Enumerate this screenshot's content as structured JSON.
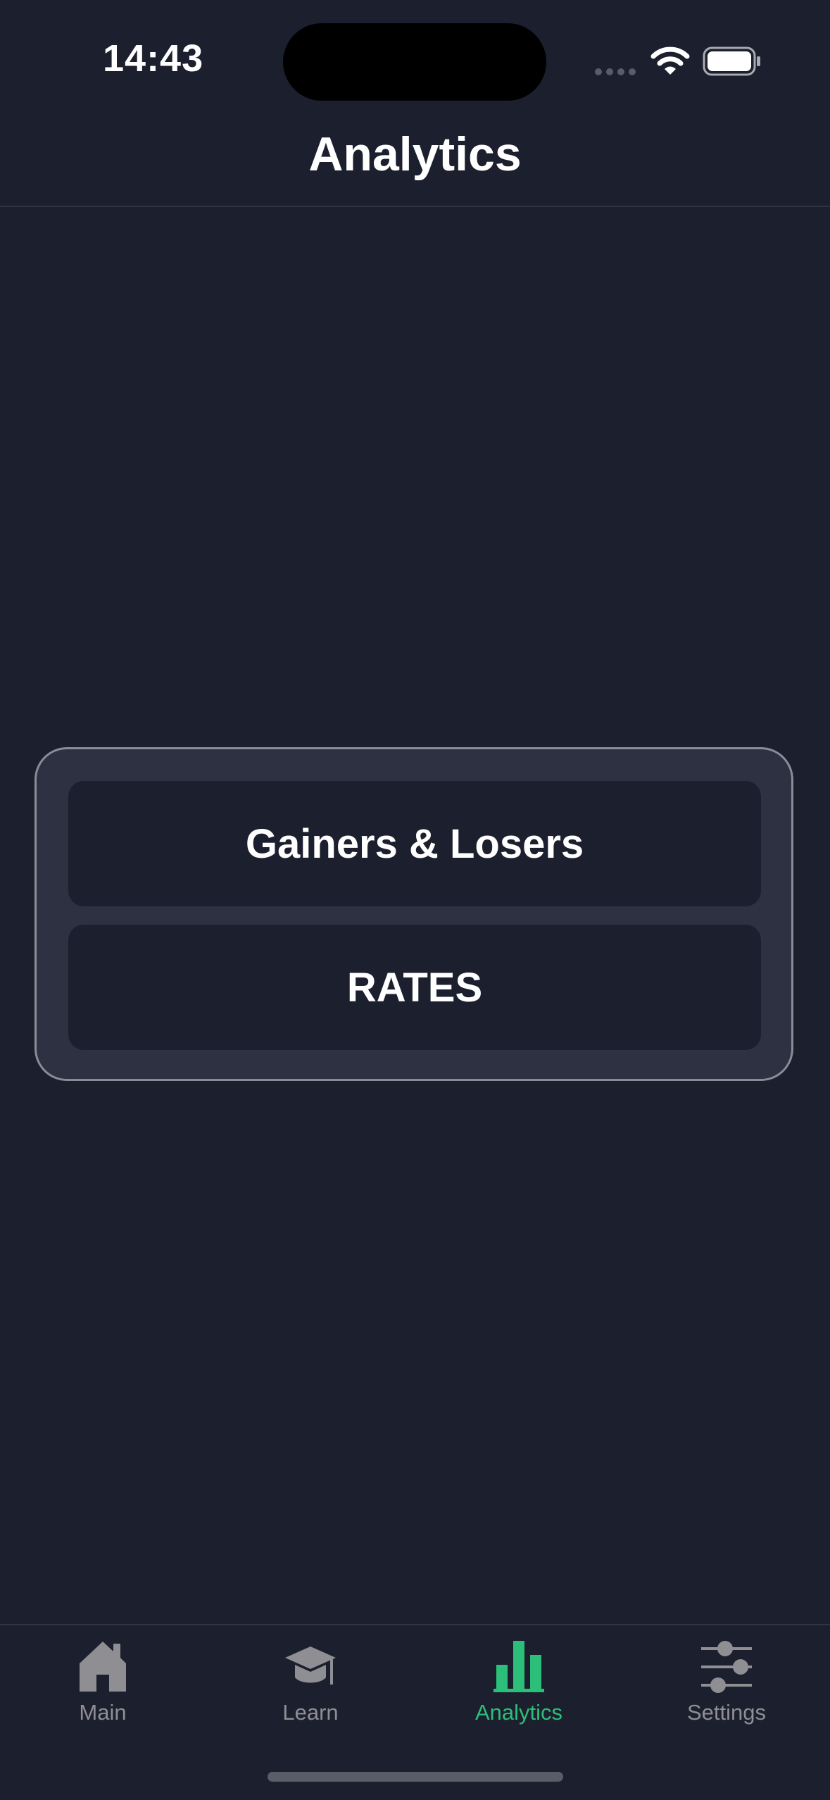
{
  "status_bar": {
    "time": "14:43"
  },
  "nav": {
    "title": "Analytics"
  },
  "menu": {
    "items": [
      {
        "label": "Gainers & Losers"
      },
      {
        "label": "RATES"
      }
    ]
  },
  "tab_bar": {
    "active_color": "#2bbf7a",
    "inactive_color": "#8e8e93",
    "items": [
      {
        "label": "Main",
        "icon": "house-icon"
      },
      {
        "label": "Learn",
        "icon": "graduation-cap-icon"
      },
      {
        "label": "Analytics",
        "icon": "bar-chart-icon",
        "active": true
      },
      {
        "label": "Settings",
        "icon": "sliders-icon"
      }
    ]
  }
}
